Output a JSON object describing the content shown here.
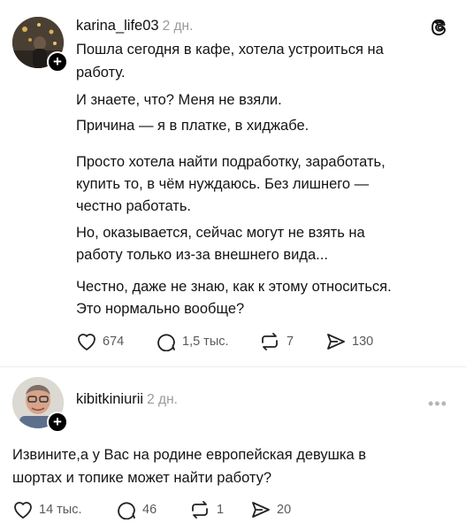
{
  "post": {
    "username": "karina_life03",
    "time": "2 дн.",
    "lines": [
      "Пошла сегодня в кафе, хотела устроиться на",
      "работу.",
      "И знаете, что? Меня не взяли.",
      "Причина — я в платке, в хиджабе.",
      "Просто хотела найти подработку, заработать,",
      "купить то, в чём нуждаюсь. Без лишнего —",
      "честно работать.",
      "Но, оказывается, сейчас могут не взять на",
      "работу только из-за внешнего вида...",
      "Честно, даже не знаю, как к этому относиться.",
      "Это нормально вообще?"
    ],
    "likes": "674",
    "replies": "1,5 тыс.",
    "reposts": "7",
    "shares": "130"
  },
  "reply": {
    "username": "kibitkiniurii",
    "time": "2 дн.",
    "more": "•••",
    "lines": [
      "Извините,а у Вас на родине европейская девушка в",
      "шортах и топике может найти работу?"
    ],
    "likes": "14 тыс.",
    "replies": "46",
    "reposts": "1",
    "shares": "20"
  },
  "icons": {
    "app": "threads-logo-icon",
    "like": "heart-icon",
    "reply": "comment-bubble-icon",
    "repost": "repost-arrows-icon",
    "share": "send-icon"
  },
  "plus_glyph": "+"
}
